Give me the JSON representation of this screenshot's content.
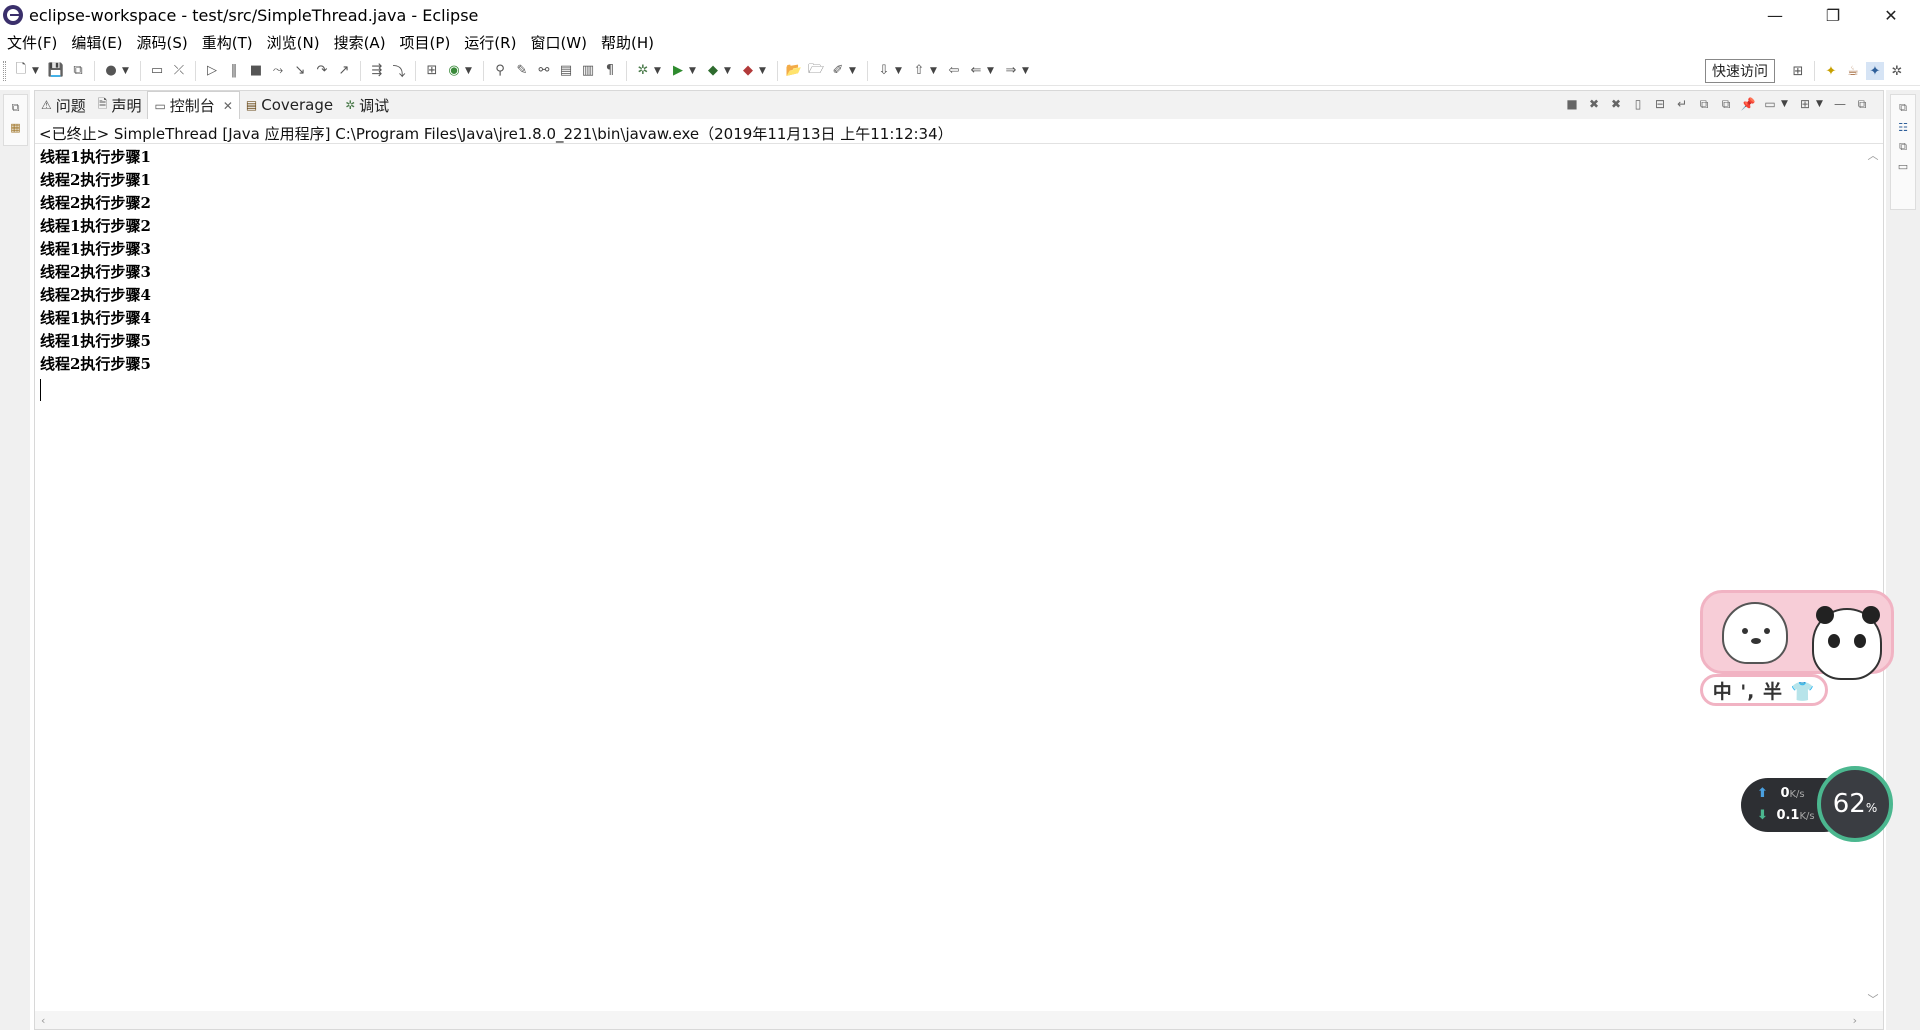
{
  "window": {
    "title": "eclipse-workspace - test/src/SimpleThread.java - Eclipse",
    "minimize": "—",
    "restore": "❐",
    "close": "✕"
  },
  "menu": [
    "文件(F)",
    "编辑(E)",
    "源码(S)",
    "重构(T)",
    "浏览(N)",
    "搜索(A)",
    "项目(P)",
    "运行(R)",
    "窗口(W)",
    "帮助(H)"
  ],
  "toolbar": {
    "quick_access": "快速访问"
  },
  "tabs": [
    {
      "label": "问题",
      "icon": "problems-icon"
    },
    {
      "label": "声明",
      "icon": "declaration-icon"
    },
    {
      "label": "控制台",
      "icon": "console-icon",
      "active": true,
      "closable": true
    },
    {
      "label": "Coverage",
      "icon": "coverage-icon"
    },
    {
      "label": "调试",
      "icon": "debug-icon"
    }
  ],
  "console": {
    "status": "<已终止> SimpleThread [Java 应用程序] C:\\Program Files\\Java\\jre1.8.0_221\\bin\\javaw.exe（2019年11月13日 上午11:12:34）",
    "lines": [
      "线程1执行步骤1",
      "线程2执行步骤1",
      "线程2执行步骤2",
      "线程1执行步骤2",
      "线程1执行步骤3",
      "线程2执行步骤3",
      "线程2执行步骤4",
      "线程1执行步骤4",
      "线程1执行步骤5",
      "线程2执行步骤5"
    ]
  },
  "ime": {
    "label": "中 ', 半 👕"
  },
  "network": {
    "upload": "0",
    "upload_unit": "K/s",
    "download": "0.1",
    "download_unit": "K/s",
    "usage": "62",
    "usage_unit": "%"
  }
}
